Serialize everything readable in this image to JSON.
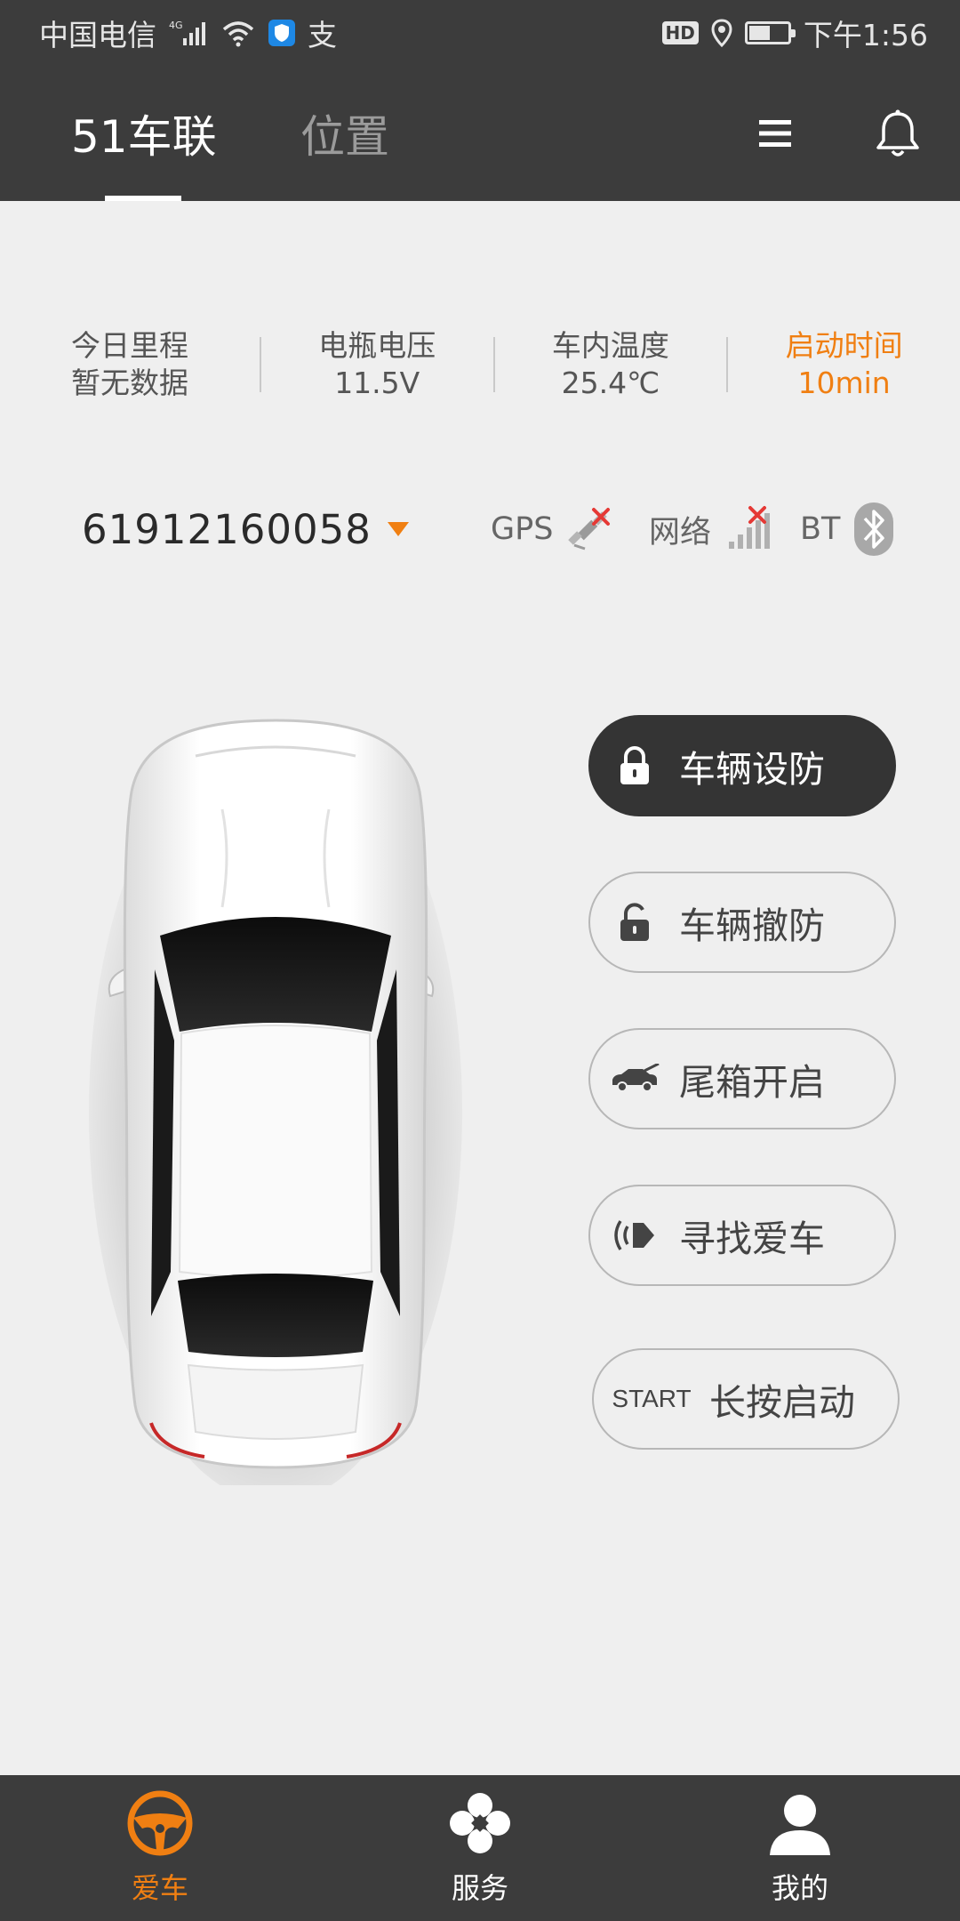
{
  "status_bar": {
    "carrier": "中国电信",
    "network_type": "4G",
    "alipay_glyph": "支",
    "hd_label": "HD",
    "time": "下午1:56",
    "battery_level": 0.55
  },
  "header": {
    "tabs": [
      {
        "label": "51车联",
        "active": true
      },
      {
        "label": "位置",
        "active": false
      }
    ]
  },
  "stats": [
    {
      "label": "今日里程",
      "value": "暂无数据",
      "highlight": false
    },
    {
      "label": "电瓶电压",
      "value": "11.5V",
      "highlight": false
    },
    {
      "label": "车内温度",
      "value": "25.4℃",
      "highlight": false
    },
    {
      "label": "启动时间",
      "value": "10min",
      "highlight": true
    }
  ],
  "device": {
    "id": "61912160058",
    "connections": {
      "gps": "GPS",
      "network": "网络",
      "bt": "BT"
    }
  },
  "actions": {
    "arm": "车辆设防",
    "disarm": "车辆撤防",
    "trunk": "尾箱开启",
    "find": "寻找爱车",
    "start_prefix": "START",
    "start": "长按启动"
  },
  "nav": [
    {
      "label": "爱车",
      "active": true
    },
    {
      "label": "服务",
      "active": false
    },
    {
      "label": "我的",
      "active": false
    }
  ],
  "colors": {
    "accent": "#f07f12",
    "bar_bg": "#3c3c3c",
    "page_bg": "#efefef"
  }
}
